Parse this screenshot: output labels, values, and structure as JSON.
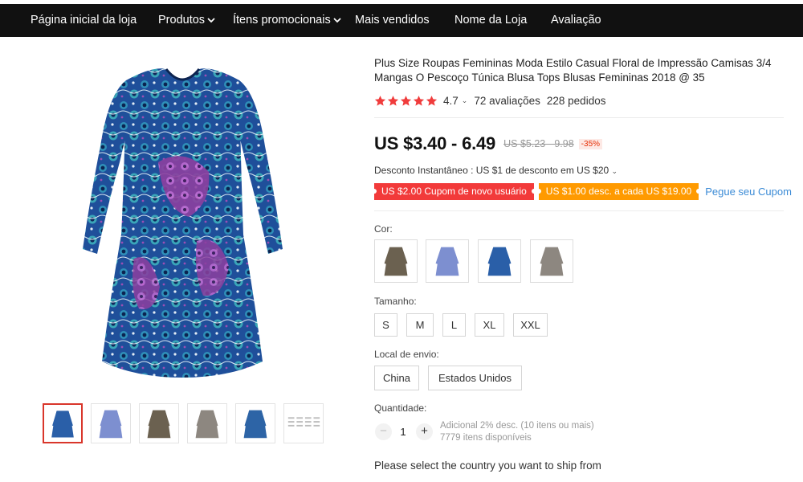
{
  "nav": {
    "items": [
      {
        "label": "Página inicial da loja",
        "dropdown": false
      },
      {
        "label": "Produtos",
        "dropdown": true
      },
      {
        "label": "Ítens promocionais",
        "dropdown": true
      },
      {
        "label": "Mais vendidos",
        "dropdown": false
      },
      {
        "label": "Nome da Loja",
        "dropdown": false
      },
      {
        "label": "Avaliação",
        "dropdown": false
      }
    ]
  },
  "product": {
    "title": "Plus Size Roupas Femininas Moda Estilo Casual Floral de Impressão Camisas 3/4 Mangas O Pescoço Túnica Blusa Tops Blusas Femininas 2018 @ 35",
    "rating": "4.7",
    "stars": 5,
    "reviews": "72 avaliações",
    "orders": "228 pedidos",
    "price": "US $3.40 - 6.49",
    "price_old": "US $5.23 - 9.98",
    "discount": "-35%",
    "instant_discount": "Desconto Instantâneo : US $1 de desconto em US $20"
  },
  "coupons": {
    "new_user": "US $2.00 Cupom de novo usuário",
    "per_amount": "US $1.00 desc. a cada US $19.00",
    "link": "Pegue seu Cupom"
  },
  "options": {
    "color_label": "Cor:",
    "size_label": "Tamanho:",
    "sizes": [
      "S",
      "M",
      "L",
      "XL",
      "XXL"
    ],
    "ship_label": "Local de envio:",
    "ship_from": [
      "China",
      "Estados Unidos"
    ],
    "quantity_label": "Quantidade:",
    "quantity": "1",
    "qty_minus": "−",
    "qty_plus": "+",
    "bulk_note": "Adicional 2% desc. (10 itens ou mais)",
    "stock": "7779 itens disponíveis",
    "ship_prompt": "Please select the country you want to ship from"
  },
  "colors": {
    "accent_red": "#f23a3a",
    "accent_orange": "#ff9a00",
    "link_blue": "#3b8bd6",
    "star": "#f03c3c",
    "nav_bg": "#111111"
  }
}
